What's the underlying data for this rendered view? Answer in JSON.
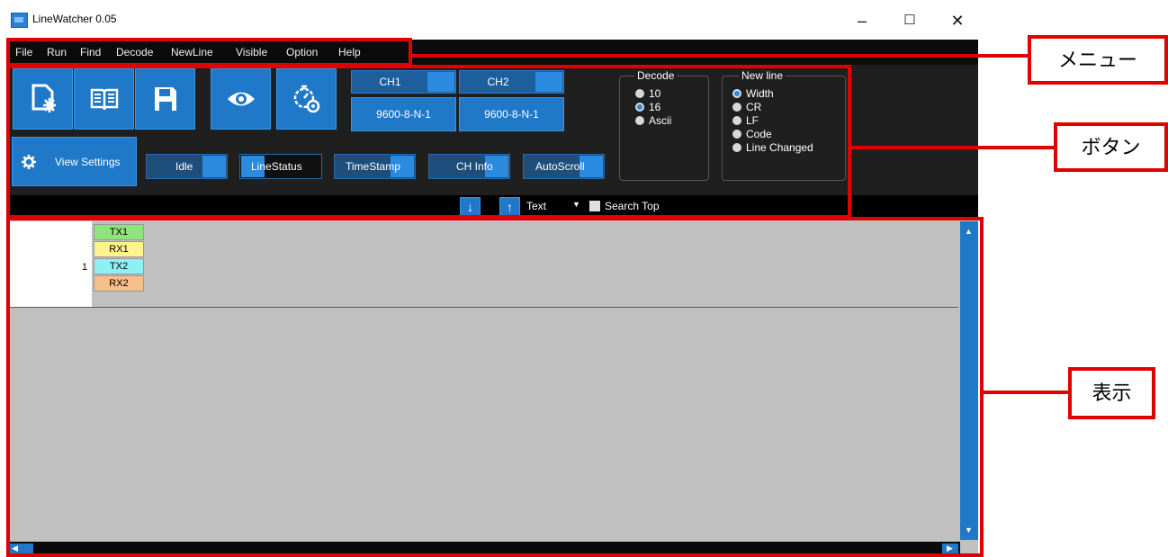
{
  "window": {
    "title": "LineWatcher 0.05",
    "minimize": "–",
    "maximize": "☐",
    "close": "✕"
  },
  "menu": [
    "File",
    "Run",
    "Find",
    "Decode",
    "NewLine",
    "Visible",
    "Option",
    "Help"
  ],
  "channels": [
    {
      "label": "CH1",
      "setting": "9600-8-N-1"
    },
    {
      "label": "CH2",
      "setting": "9600-8-N-1"
    }
  ],
  "view_settings": "View Settings",
  "toggles": [
    "Idle",
    "LineStatus",
    "TimeStamp",
    "CH Info",
    "AutoScroll"
  ],
  "decode": {
    "title": "Decode",
    "options": [
      "10",
      "16",
      "Ascii"
    ],
    "selected": "16"
  },
  "newline": {
    "title": "New line",
    "options": [
      "Width",
      "CR",
      "LF",
      "Code",
      "Line Changed"
    ],
    "selected": "Width"
  },
  "search": {
    "down": "↓",
    "up": "↑",
    "mode": "Text",
    "search_top": "Search Top"
  },
  "rows": [
    {
      "number": "1",
      "tags": [
        "TX1",
        "RX1",
        "TX2",
        "RX2"
      ]
    }
  ],
  "tag_colors": {
    "TX1": "#8ee37a",
    "RX1": "#fff38e",
    "TX2": "#8ef1f1",
    "RX2": "#f7bf8a"
  },
  "annotations": {
    "menu": "メニュー",
    "buttons": "ボタン",
    "display": "表示"
  },
  "accent": "#e00000"
}
